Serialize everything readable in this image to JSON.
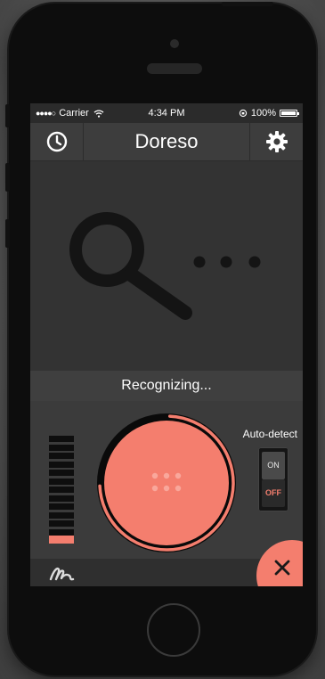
{
  "status_bar": {
    "signal_dots": "●●●●○",
    "carrier": "Carrier",
    "wifi_icon": "wifi-icon",
    "time": "4:34 PM",
    "battery_percent": "100%"
  },
  "header": {
    "title": "Doreso",
    "history_icon": "clock-icon",
    "settings_icon": "gear-icon"
  },
  "main": {
    "status_text": "Recognizing...",
    "illustration_icon": "magnifier-icon"
  },
  "controls": {
    "auto_detect_label": "Auto-detect",
    "switch_on_label": "ON",
    "switch_off_label": "OFF",
    "switch_state": "off",
    "record_progress": 0.75,
    "audio_level_segments_lit": 1,
    "audio_level_segments_total": 13
  },
  "bottom_bar": {
    "logo_icon": "doreso-logo-icon",
    "close_icon": "close-icon"
  },
  "colors": {
    "accent": "#f47e6e",
    "background": "#3a3a3a",
    "text": "#ffffff"
  }
}
